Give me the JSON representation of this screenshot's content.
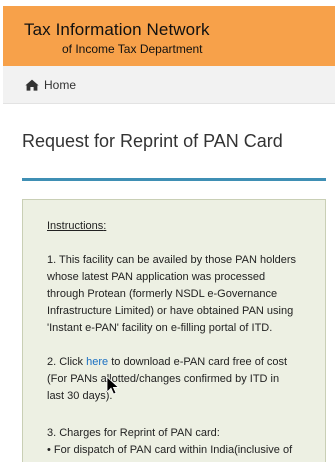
{
  "header": {
    "title_line1": "Tax Information Network",
    "title_line2": "of Income Tax Department",
    "background_color": "#f7a14a"
  },
  "breadcrumb": {
    "icon": "home-icon",
    "label": "Home"
  },
  "page": {
    "title": "Request for Reprint of PAN Card",
    "accent_color": "#3f8fb4"
  },
  "instructions": {
    "heading": "Instructions",
    "heading_suffix": ":",
    "item1": {
      "lines": [
        "1. This facility can be availed by those PAN holders",
        "whose latest PAN application was processed",
        "through Protean (formerly NSDL e-Governance",
        "Infrastructure Limited) or have obtained PAN using",
        "'Instant e-PAN' facility on e-filling portal of ITD."
      ]
    },
    "item2": {
      "prefix": "2. Click ",
      "link_text": "here",
      "suffix": " to download e-PAN card free of cost",
      "lines": [
        "(For PANs allotted/changes confirmed by ITD in",
        "last 30 days)."
      ],
      "link_color": "#1a6fc2"
    },
    "item3": {
      "lines": [
        "3. Charges for Reprint of PAN card:",
        "• For dispatch of PAN card within India(inclusive of"
      ]
    }
  }
}
